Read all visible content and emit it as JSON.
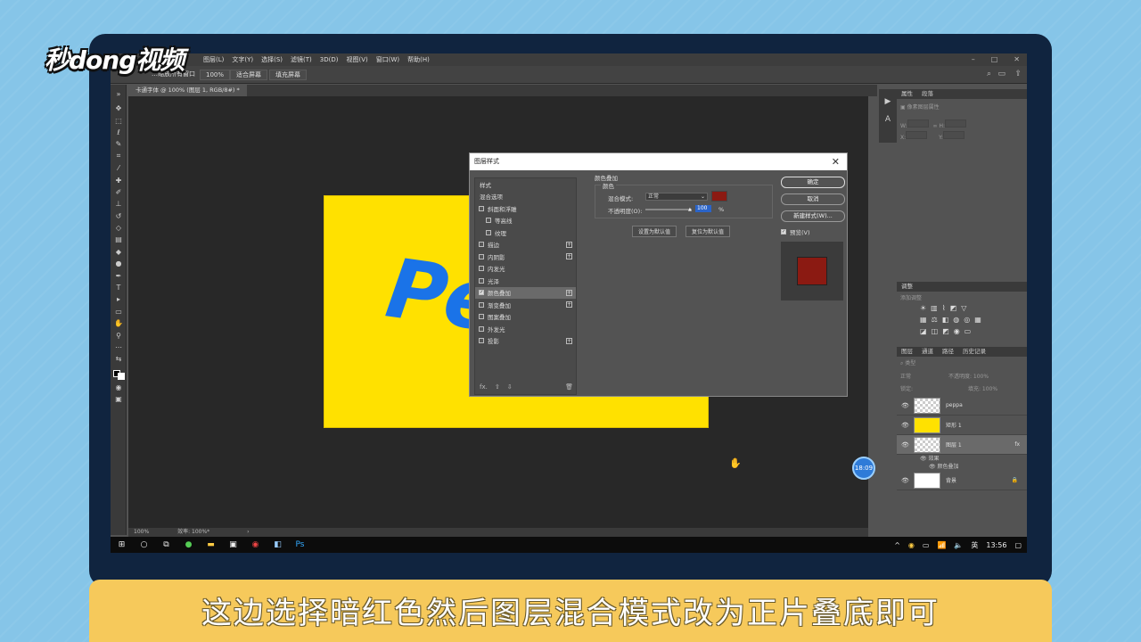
{
  "watermark": "秒dong视频",
  "caption": "这边选择暗红色然后图层混合模式改为正片叠底即可",
  "menu": [
    "图层(L)",
    "文字(Y)",
    "选择(S)",
    "滤镜(T)",
    "3D(D)",
    "视图(V)",
    "窗口(W)",
    "帮助(H)"
  ],
  "options_bar": {
    "truncated_left": "…缩放所有窗口",
    "zoom": "100%",
    "fit_screen": "适合屏幕",
    "fill_screen": "填充屏幕"
  },
  "doc_tab": "卡通字体 @ 100% (图层 1, RGB/8#) *",
  "canvas_text": "Pe",
  "status": {
    "zoom": "100%",
    "efficiency": "效率: 100%*"
  },
  "properties_panel": {
    "tabs": [
      "属性",
      "段落"
    ],
    "subtitle": "像素图层属性",
    "w": "W:",
    "h": "H:",
    "x": "X:",
    "y": "Y:"
  },
  "adjust_panel": {
    "title": "调整",
    "subtitle": "添加调整"
  },
  "layers_panel": {
    "tabs": [
      "图层",
      "通道",
      "路径",
      "历史记录"
    ],
    "filter": "类型",
    "mode": "正常",
    "opacity_label": "不透明度:",
    "opacity": "100%",
    "lock_label": "锁定:",
    "fill_label": "填充:",
    "fill": "100%",
    "layers": [
      {
        "name": "peppa"
      },
      {
        "name": "矩形 1"
      },
      {
        "name": "图层 1",
        "fx": "fx"
      },
      {
        "name": "背景"
      }
    ],
    "effects_label": "效果",
    "color_overlay_effect": "颜色叠加"
  },
  "time_badge": "18:09",
  "dialog": {
    "title": "图层样式",
    "list_header": "样式",
    "blend_options": "混合选项",
    "items": [
      {
        "label": "斜面和浮雕",
        "checked": false,
        "plus": false,
        "sub": false
      },
      {
        "label": "等高线",
        "checked": false,
        "plus": false,
        "sub": true
      },
      {
        "label": "纹理",
        "checked": false,
        "plus": false,
        "sub": true
      },
      {
        "label": "描边",
        "checked": false,
        "plus": true,
        "sub": false
      },
      {
        "label": "内阴影",
        "checked": false,
        "plus": true,
        "sub": false
      },
      {
        "label": "内发光",
        "checked": false,
        "plus": false,
        "sub": false
      },
      {
        "label": "光泽",
        "checked": false,
        "plus": false,
        "sub": false
      },
      {
        "label": "颜色叠加",
        "checked": true,
        "plus": true,
        "sub": false
      },
      {
        "label": "渐变叠加",
        "checked": false,
        "plus": true,
        "sub": false
      },
      {
        "label": "图案叠加",
        "checked": false,
        "plus": false,
        "sub": false
      },
      {
        "label": "外发光",
        "checked": false,
        "plus": false,
        "sub": false
      },
      {
        "label": "投影",
        "checked": false,
        "plus": true,
        "sub": false
      }
    ],
    "section_title": "颜色叠加",
    "group_title": "颜色",
    "blend_mode_label": "混合模式:",
    "blend_mode_value": "正常",
    "opacity_label": "不透明度(O):",
    "opacity_value": "100",
    "opacity_unit": "%",
    "set_default": "设置为默认值",
    "reset_default": "复位为默认值",
    "ok": "确定",
    "cancel": "取消",
    "new_style": "新建样式(W)...",
    "preview_label": "预览(V)",
    "overlay_color": "#8b1a12"
  },
  "taskbar": {
    "lang": "英",
    "time": "13:56"
  }
}
